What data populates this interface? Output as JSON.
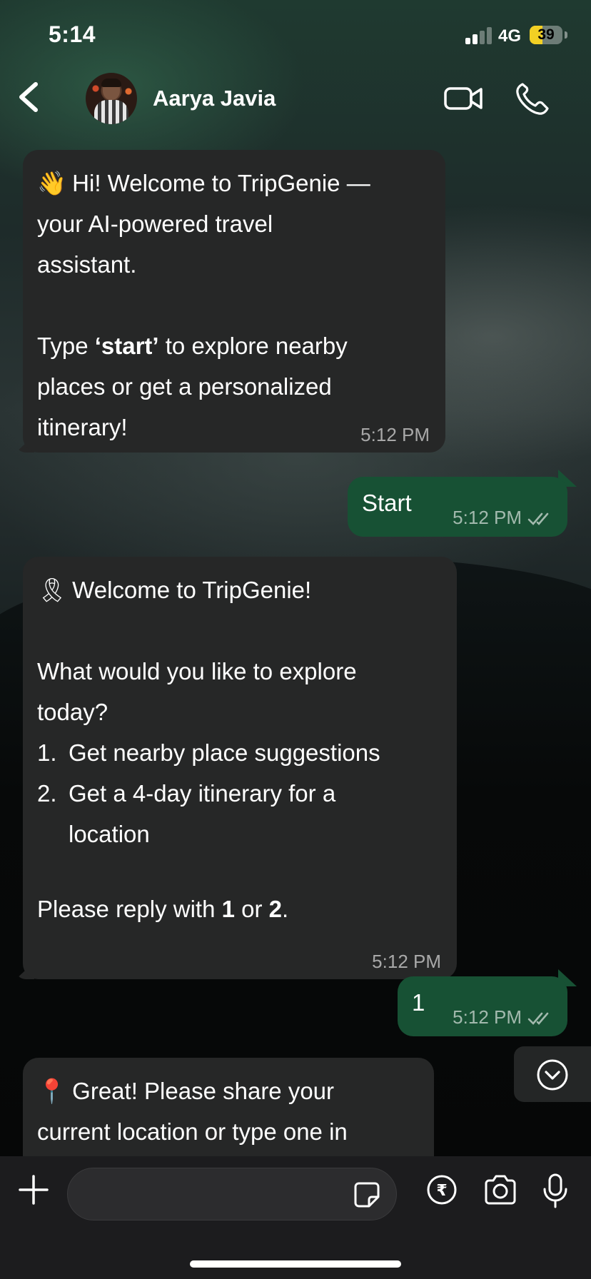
{
  "status_bar": {
    "time": "5:14",
    "network": "4G",
    "battery": "39",
    "battery_level": 0.39,
    "signal_bars": 2
  },
  "header": {
    "contact_name": "Aarya Javia",
    "icons": [
      "back-chevron-icon",
      "video-call-icon",
      "phone-icon"
    ]
  },
  "messages": [
    {
      "direction": "incoming",
      "emoji": "👋",
      "line1": "Hi! Welcome to TripGenie —",
      "line2": "your AI-powered travel",
      "line3": "assistant.",
      "line4_prefix": "Type ",
      "line4_bold": "‘start’",
      "line4_suffix": " to explore nearby",
      "line5": "places or get a personalized",
      "line6": "itinerary!",
      "time": "5:12 PM"
    },
    {
      "direction": "outgoing",
      "text": "Start",
      "time": "5:12 PM",
      "status": "read"
    },
    {
      "direction": "incoming",
      "emoji": "🎗",
      "line1": "Welcome to TripGenie!",
      "line2": "What would you like to explore",
      "line3": "today?",
      "options": [
        {
          "num": "1.",
          "text": "Get nearby place suggestions"
        },
        {
          "num": "2.",
          "text_line1": "Get a 4-day itinerary for a",
          "text_line2": "location"
        }
      ],
      "reply_prefix": "Please reply with ",
      "reply_b1": "1",
      "reply_mid": " or ",
      "reply_b2": "2",
      "reply_suffix": ".",
      "time": "5:12 PM"
    },
    {
      "direction": "outgoing",
      "text": "1",
      "time": "5:12 PM",
      "status": "read"
    },
    {
      "direction": "incoming",
      "emoji": "📍",
      "line1": "Great! Please share your",
      "line2": "current location or type one in",
      "partial": true
    }
  ],
  "composer": {
    "value": "",
    "icons": [
      "plus-icon",
      "sticker-icon",
      "rupee-payment-icon",
      "camera-icon",
      "microphone-icon"
    ]
  },
  "colors": {
    "incoming_bubble": "#262727",
    "outgoing_bubble": "#175134",
    "battery_fill": "#f2d024"
  }
}
